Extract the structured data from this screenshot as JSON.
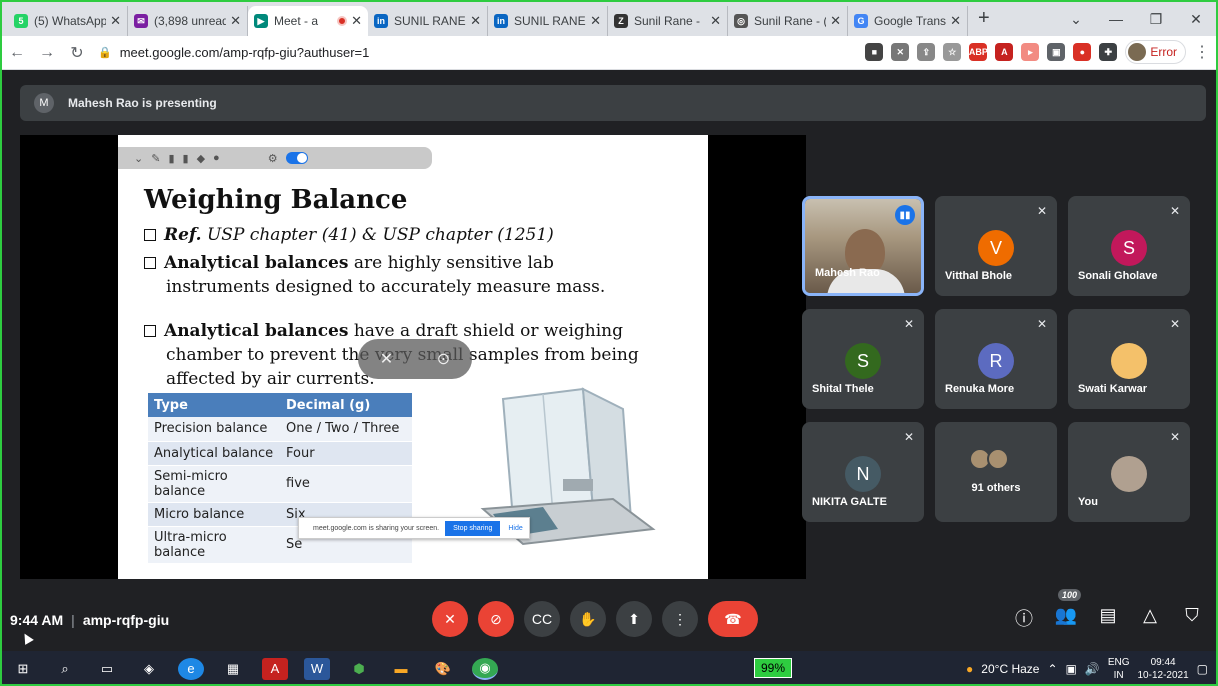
{
  "browser": {
    "tabs": [
      {
        "label": "(5) WhatsApp",
        "fav_color": "#25d366",
        "fav_text": "5",
        "icon": "whatsapp-icon"
      },
      {
        "label": "(3,898 unread",
        "fav_color": "#7b1fa2",
        "fav_text": "✉",
        "icon": "mail-icon"
      },
      {
        "label": "Meet - a",
        "fav_color": "#00897b",
        "fav_text": "▶",
        "icon": "meet-icon",
        "active": true,
        "recording": true
      },
      {
        "label": "SUNIL RANE",
        "fav_color": "#0a66c2",
        "fav_text": "in",
        "icon": "linkedin-icon"
      },
      {
        "label": "SUNIL RANE",
        "fav_color": "#0a66c2",
        "fav_text": "in",
        "icon": "linkedin-icon"
      },
      {
        "label": "Sunil Rane -",
        "fav_color": "#333333",
        "fav_text": "Z",
        "icon": "zoominfo-icon"
      },
      {
        "label": "Sunil Rane - (",
        "fav_color": "#555555",
        "fav_text": "◎",
        "icon": "globe-icon"
      },
      {
        "label": "Google Trans",
        "fav_color": "#4285f4",
        "fav_text": "G",
        "icon": "translate-icon"
      }
    ],
    "new_tab": "+",
    "url": "meet.google.com/amp-rqfp-giu?authuser=1",
    "profile_status": "Error"
  },
  "meet": {
    "presenter_initial": "M",
    "presenting_text": "Mahesh Rao is presenting",
    "slide": {
      "title": "Weighing Balance",
      "ref_label": "Ref.",
      "ref_text": "USP chapter (41) & USP chapter (1251)",
      "b1_bold": "Analytical balances",
      "b1_rest": "are highly sensitive lab",
      "b1_line2": "instruments designed to accurately measure mass.",
      "b2_bold": "Analytical balances",
      "b2_rest": "have a draft shield or weighing",
      "b2_line2": "chamber to prevent the very small samples from being",
      "b2_line3": "affected by air currents.",
      "table_headers": [
        "Type",
        "Decimal (g)"
      ],
      "table_rows": [
        [
          "Precision balance",
          "One / Two /  Three"
        ],
        [
          "Analytical balance",
          "Four"
        ],
        [
          "Semi-micro balance",
          "five"
        ],
        [
          "Micro balance",
          "Six"
        ],
        [
          "Ultra-micro balance",
          "Se"
        ]
      ]
    },
    "share_bar": {
      "text": "meet.google.com is sharing your screen.",
      "stop": "Stop sharing",
      "hide": "Hide"
    },
    "participants": [
      {
        "name": "Mahesh Rao",
        "type": "video",
        "speaking": true
      },
      {
        "name": "Vitthal Bhole",
        "initial": "V",
        "color": "#ef6c00"
      },
      {
        "name": "Sonali Gholave",
        "initial": "S",
        "color": "#c2185b"
      },
      {
        "name": "Shital Thele",
        "initial": "S",
        "color": "#33691e"
      },
      {
        "name": "Renuka More",
        "initial": "R",
        "color": "#5c6bc0"
      },
      {
        "name": "Swati Karwar",
        "type": "avatar"
      },
      {
        "name": "NIKITA GALTE",
        "initial": "N",
        "color": "#455a64"
      },
      {
        "name": "91 others",
        "type": "others"
      },
      {
        "name": "You",
        "type": "avatar"
      }
    ],
    "time": "9:44 AM",
    "meeting_code": "amp-rqfp-giu",
    "people_count": "100"
  },
  "taskbar": {
    "battery": "99%",
    "weather": "20°C  Haze",
    "lang_line1": "ENG",
    "lang_line2": "IN",
    "time": "09:44",
    "date": "10-12-2021"
  }
}
